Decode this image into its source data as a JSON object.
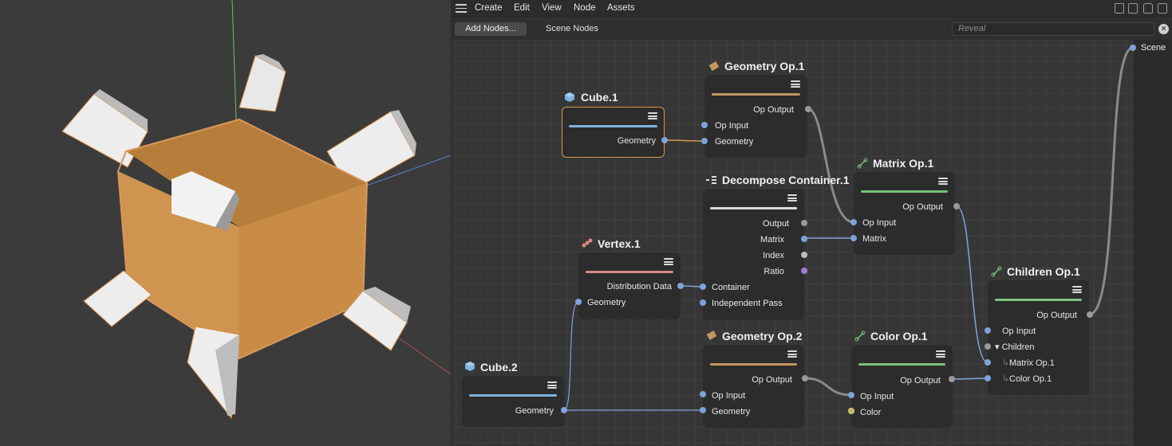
{
  "menubar": {
    "items": [
      "Create",
      "Edit",
      "View",
      "Node",
      "Assets"
    ]
  },
  "toolbar": {
    "add_nodes_label": "Add Nodes...",
    "tab_label": "Scene Nodes",
    "search_placeholder": "Reveal"
  },
  "scene_port_label": "Scene",
  "nodes": {
    "cube1": {
      "title": "Cube.1",
      "outputs": [
        "Geometry"
      ],
      "bar_color": "#7fb3de"
    },
    "geomop1": {
      "title": "Geometry Op.1",
      "outputs": [
        "Op Output"
      ],
      "inputs": [
        "Op Input",
        "Geometry"
      ],
      "bar_color": "#c4975f"
    },
    "decompose": {
      "title": "Decompose Container.1",
      "outputs": [
        "Output",
        "Matrix",
        "Index",
        "Ratio"
      ],
      "inputs": [
        "Container",
        "Independent Pass"
      ],
      "bar_color": "#dcdcdc"
    },
    "vertex1": {
      "title": "Vertex.1",
      "outputs": [
        "Distribution Data"
      ],
      "inputs": [
        "Geometry"
      ],
      "bar_color": "#d98a82"
    },
    "matrixop1": {
      "title": "Matrix Op.1",
      "outputs": [
        "Op Output"
      ],
      "inputs": [
        "Op Input",
        "Matrix"
      ],
      "bar_color": "#79c27c"
    },
    "childrenop1": {
      "title": "Children Op.1",
      "outputs": [
        "Op Output"
      ],
      "inputs": [
        "Op Input",
        "Children",
        "Matrix Op.1",
        "Color Op.1"
      ],
      "bar_color": "#79c27c"
    },
    "cube2": {
      "title": "Cube.2",
      "outputs": [
        "Geometry"
      ],
      "bar_color": "#7fb3de"
    },
    "geomop2": {
      "title": "Geometry Op.2",
      "outputs": [
        "Op Output"
      ],
      "inputs": [
        "Op Input",
        "Geometry"
      ],
      "bar_color": "#c4975f"
    },
    "colorop1": {
      "title": "Color Op.1",
      "outputs": [
        "Op Output"
      ],
      "inputs": [
        "Op Input",
        "Color"
      ],
      "bar_color": "#79c27c"
    }
  },
  "colors": {
    "cube_orange": "#c8914a",
    "selection_outline": "#d99a4e",
    "port_blue": "#7fa3d9"
  }
}
